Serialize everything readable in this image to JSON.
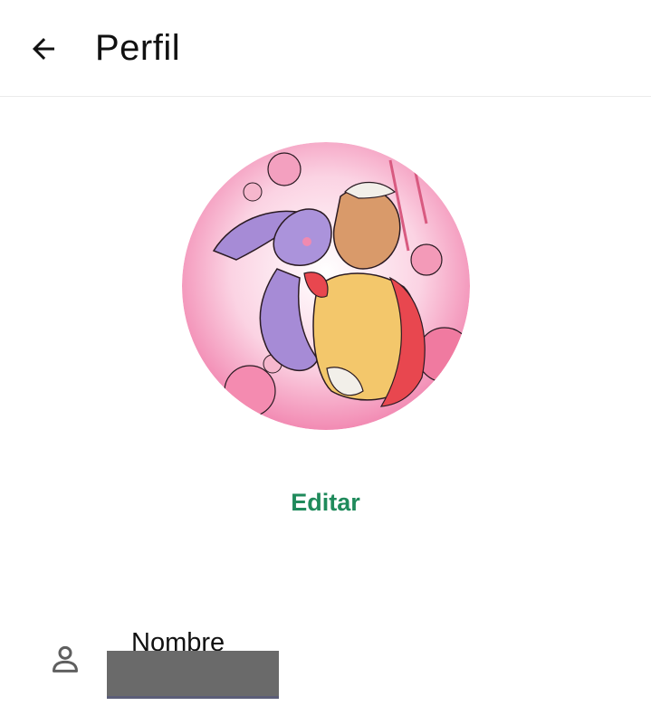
{
  "header": {
    "title": "Perfil",
    "back_icon": "arrow-back-icon"
  },
  "profile": {
    "avatar_icon": "profile-photo",
    "edit_label": "Editar"
  },
  "fields": {
    "name": {
      "icon": "person-icon",
      "label": "Nombre",
      "value": ""
    }
  },
  "colors": {
    "accent": "#1f8a5b",
    "text": "#111111",
    "divider": "#ebebeb"
  }
}
